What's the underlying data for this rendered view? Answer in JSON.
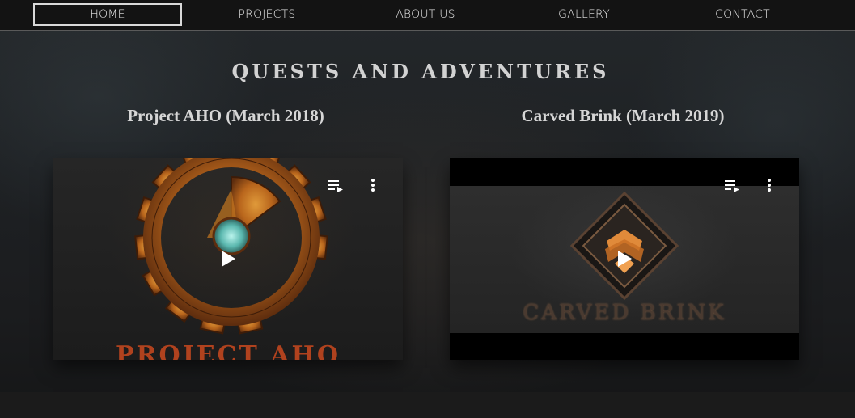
{
  "nav": {
    "items": [
      {
        "label": "HOME",
        "active": true
      },
      {
        "label": "PROJECTS",
        "active": false
      },
      {
        "label": "ABOUT US",
        "active": false
      },
      {
        "label": "GALLERY",
        "active": false
      },
      {
        "label": "CONTACT",
        "active": false
      }
    ]
  },
  "main": {
    "title": "QUESTS AND ADVENTURES",
    "projects": [
      {
        "title": "Project AHO (March 2018)",
        "video_text": "PROJECT AHO"
      },
      {
        "title": "Carved Brink (March 2019)",
        "video_text": "CARVED BRINK"
      }
    ]
  },
  "icons": {
    "playlist": "playlist-icon",
    "more": "more-vertical-icon",
    "play": "play-icon"
  },
  "colors": {
    "nav_bg": "#131313",
    "text": "#d2d2d2",
    "accent_orange": "#b0421e"
  }
}
